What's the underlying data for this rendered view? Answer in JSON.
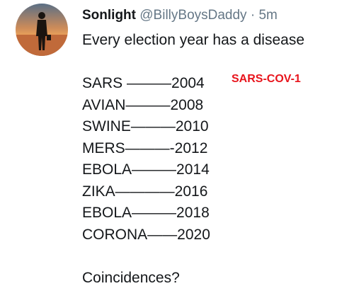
{
  "tweet": {
    "author_name": "Sonlight",
    "handle": "@BillyBoysDaddy",
    "separator": "·",
    "time": "5m",
    "intro": "Every election year has a disease",
    "lines": [
      "SARS ———2004",
      "AVIAN———2008",
      "SWINE———2010",
      "MERS———-2012",
      "EBOLA———2014",
      "ZIKA————2016",
      "EBOLA———2018",
      "CORONA——2020"
    ],
    "closing": "Coincidences?"
  },
  "annotation": {
    "text": "SARS-COV-1",
    "color": "#e8141c"
  },
  "avatar": {
    "icon": "silhouette-sunset-avatar"
  }
}
